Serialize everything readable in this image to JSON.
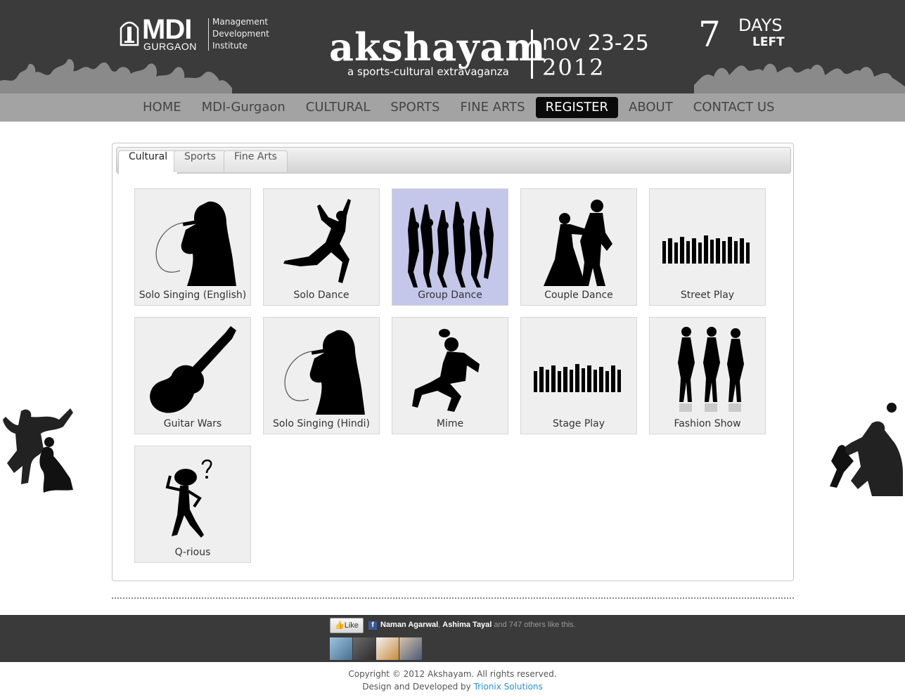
{
  "header": {
    "logo": {
      "big": "MDI",
      "city": "GURGAON",
      "lines": [
        "Management",
        "Development",
        "Institute"
      ]
    },
    "brand": "akshayam",
    "tagline": "a sports-cultural extravaganza",
    "dates": "nov 23-25",
    "year": "2012",
    "countdown": {
      "number": "7",
      "days": "DAYS",
      "left": "LEFT"
    }
  },
  "nav": {
    "items": [
      {
        "label": "HOME",
        "active": false
      },
      {
        "label": "MDI-Gurgaon",
        "active": false
      },
      {
        "label": "CULTURAL",
        "active": false
      },
      {
        "label": "SPORTS",
        "active": false
      },
      {
        "label": "FINE ARTS",
        "active": false
      },
      {
        "label": "REGISTER",
        "active": true
      },
      {
        "label": "ABOUT",
        "active": false
      },
      {
        "label": "CONTACT US",
        "active": false
      }
    ]
  },
  "tabs": [
    {
      "label": "Cultural",
      "active": true
    },
    {
      "label": "Sports",
      "active": false
    },
    {
      "label": "Fine Arts",
      "active": false
    }
  ],
  "events": [
    {
      "label": "Solo Singing (English)",
      "icon": "singer-silhouette-icon",
      "highlighted": false
    },
    {
      "label": "Solo Dance",
      "icon": "dancer-silhouette-icon",
      "highlighted": false
    },
    {
      "label": "Group Dance",
      "icon": "group-dance-icon",
      "highlighted": true
    },
    {
      "label": "Couple Dance",
      "icon": "couple-dance-icon",
      "highlighted": false
    },
    {
      "label": "Street Play",
      "icon": "street-play-icon",
      "highlighted": false
    },
    {
      "label": "Guitar Wars",
      "icon": "guitar-icon",
      "highlighted": false
    },
    {
      "label": "Solo Singing (Hindi)",
      "icon": "singer-silhouette-icon",
      "highlighted": false
    },
    {
      "label": "Mime",
      "icon": "mime-icon",
      "highlighted": false
    },
    {
      "label": "Stage Play",
      "icon": "stage-play-icon",
      "highlighted": false
    },
    {
      "label": "Fashion Show",
      "icon": "fashion-show-icon",
      "highlighted": false
    },
    {
      "label": "Q-rious",
      "icon": "thinking-figure-icon",
      "highlighted": false
    }
  ],
  "footer": {
    "like_button": "Like",
    "like_names": [
      "Naman Agarwal",
      "Ashima Tayal"
    ],
    "like_rest": "and 747 others like this.",
    "copyright": "Copyright © 2012 Akshayam. All rights reserved.",
    "credit_prefix": "Design and Developed by",
    "credit_link": "Trionix Solutions"
  },
  "colors": {
    "header_bg": "#3b3b3b",
    "nav_bg": "#a3a3a3",
    "active_nav": "#0a0a0a",
    "highlight_tile": "#c4c6ea",
    "link": "#2a8fd0"
  }
}
